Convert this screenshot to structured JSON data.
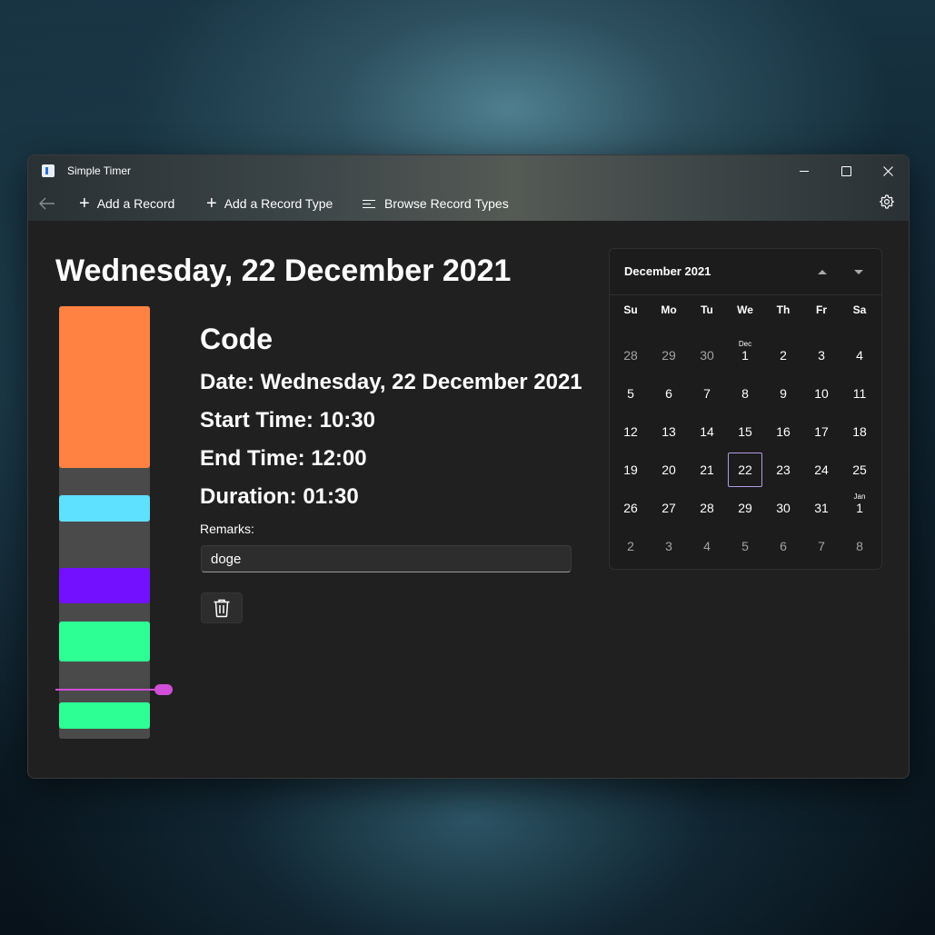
{
  "window": {
    "title": "Simple Timer",
    "controls": {
      "minimize": "minimize",
      "maximize": "maximize",
      "close": "close"
    }
  },
  "toolbar": {
    "add_record_label": "Add a Record",
    "add_record_type_label": "Add a Record Type",
    "browse_record_types_label": "Browse Record Types",
    "icons": {
      "back": "back-arrow-icon",
      "add": "plus-icon",
      "browse": "list-icon",
      "settings": "gear-icon"
    }
  },
  "page": {
    "title": "Wednesday, 22 December 2021"
  },
  "timeline": {
    "blocks": [
      {
        "color": "#ff8243"
      },
      {
        "color": "#5ee0ff"
      },
      {
        "color": "#7210ff"
      },
      {
        "color": "#2dff95"
      },
      {
        "color": "#2dff95"
      }
    ],
    "current_time_color": "#d14ed8"
  },
  "record": {
    "type_name": "Code",
    "date_line": "Date: Wednesday, 22 December 2021",
    "start_line": "Start Time: 10:30",
    "end_line": "End Time: 12:00",
    "duration_line": "Duration: 01:30",
    "remarks_label": "Remarks:",
    "remarks_value": "doge",
    "delete_icon": "trash-icon"
  },
  "calendar": {
    "month_label": "December 2021",
    "weekdays": [
      "Su",
      "Mo",
      "Tu",
      "We",
      "Th",
      "Fr",
      "Sa"
    ],
    "days": [
      {
        "d": "28",
        "out": true
      },
      {
        "d": "29",
        "out": true
      },
      {
        "d": "30",
        "out": true
      },
      {
        "d": "1",
        "label": "Dec"
      },
      {
        "d": "2"
      },
      {
        "d": "3"
      },
      {
        "d": "4"
      },
      {
        "d": "5"
      },
      {
        "d": "6"
      },
      {
        "d": "7"
      },
      {
        "d": "8"
      },
      {
        "d": "9"
      },
      {
        "d": "10"
      },
      {
        "d": "11"
      },
      {
        "d": "12"
      },
      {
        "d": "13"
      },
      {
        "d": "14"
      },
      {
        "d": "15"
      },
      {
        "d": "16"
      },
      {
        "d": "17"
      },
      {
        "d": "18"
      },
      {
        "d": "19"
      },
      {
        "d": "20"
      },
      {
        "d": "21"
      },
      {
        "d": "22",
        "today": true
      },
      {
        "d": "23"
      },
      {
        "d": "24"
      },
      {
        "d": "25"
      },
      {
        "d": "26"
      },
      {
        "d": "27"
      },
      {
        "d": "28"
      },
      {
        "d": "29"
      },
      {
        "d": "30"
      },
      {
        "d": "31"
      },
      {
        "d": "1",
        "label": "Jan"
      },
      {
        "d": "2",
        "out": true
      },
      {
        "d": "3",
        "out": true
      },
      {
        "d": "4",
        "out": true
      },
      {
        "d": "5",
        "out": true
      },
      {
        "d": "6",
        "out": true
      },
      {
        "d": "7",
        "out": true
      },
      {
        "d": "8",
        "out": true
      }
    ],
    "icons": {
      "prev": "caret-up-icon",
      "next": "caret-down-icon"
    }
  }
}
